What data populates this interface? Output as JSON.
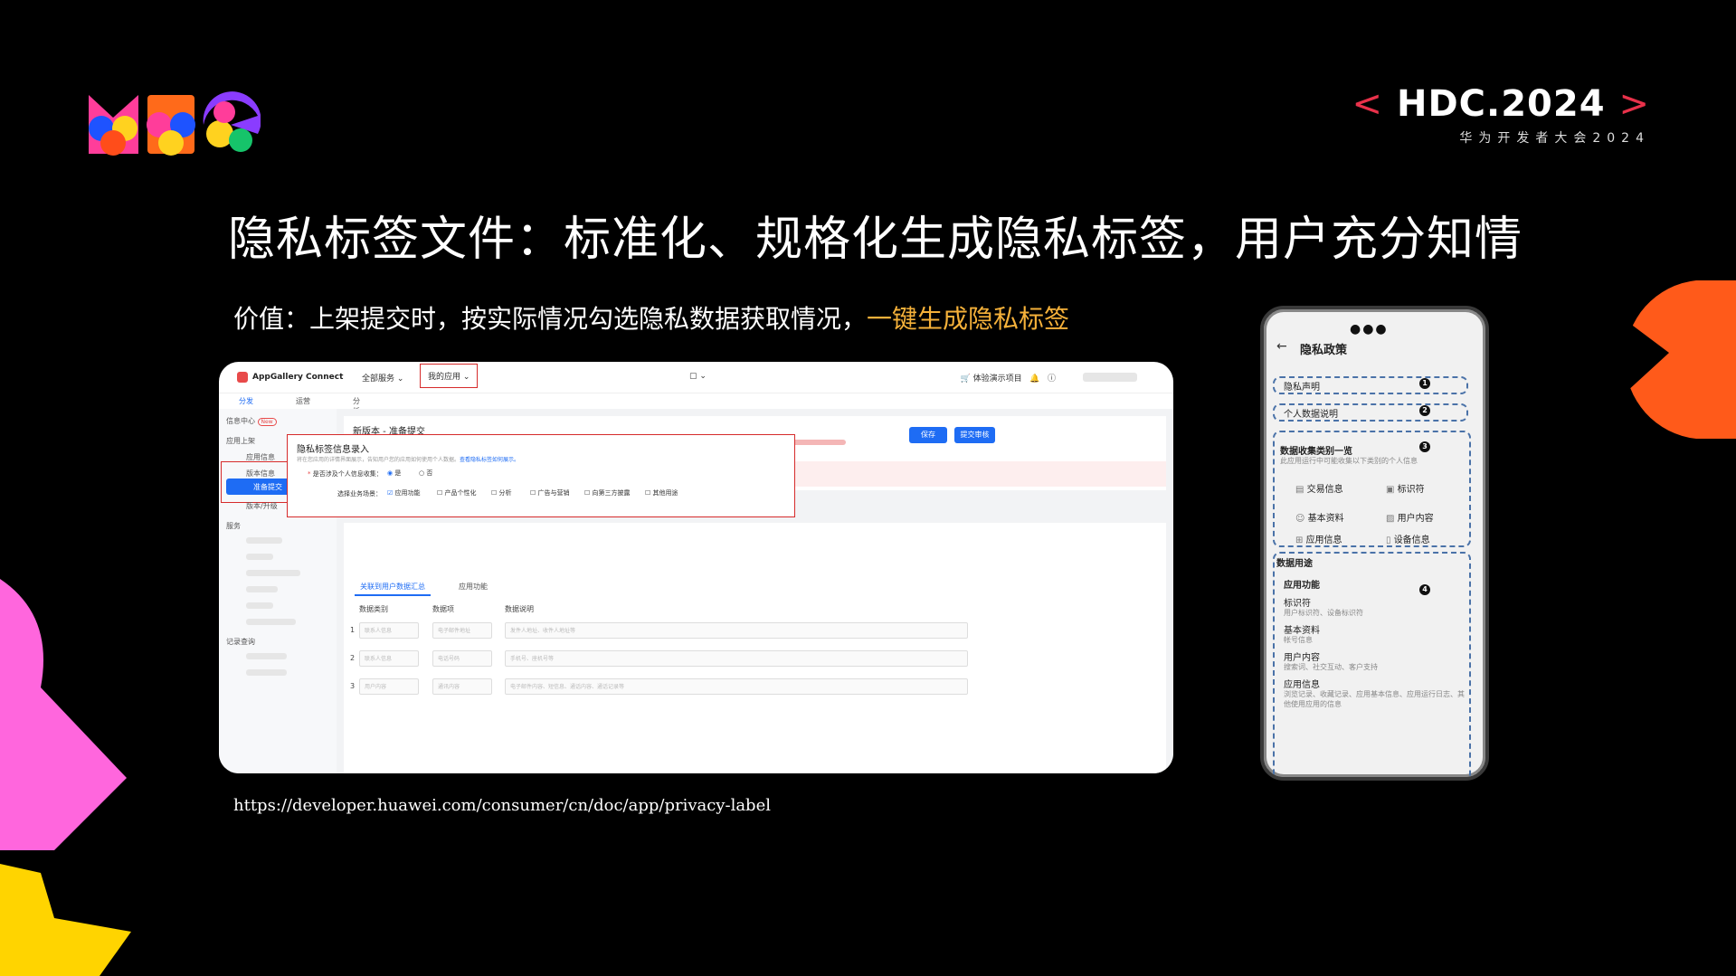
{
  "event": {
    "brand_left_bracket": "<",
    "brand_name": "HDC.2024",
    "brand_right_bracket": ">",
    "brand_sub": "华为开发者大会2024"
  },
  "slide": {
    "title": "隐私标签文件：标准化、规格化生成隐私标签，用户充分知情",
    "subtitle_prefix": "价值：上架提交时，按实际情况勾选隐私数据获取情况，",
    "subtitle_highlight": "一键生成隐私标签",
    "url": "https://developer.huawei.com/consumer/cn/doc/app/privacy-label"
  },
  "console": {
    "product": "AppGallery Connect",
    "menu_all": "全部服务",
    "menu_my": "我的应用",
    "demo": "体验演示项目",
    "tabs": [
      "分发",
      "运营",
      "分析"
    ],
    "sidebar": {
      "info_center": "信息中心",
      "new_badge": "New",
      "app_listing": "应用上架",
      "app_info": "应用信息",
      "version_info": "版本信息",
      "prepare_submit": "准备提交",
      "version_upgrade": "版本/升级",
      "services": "服务",
      "records": "记录查询"
    },
    "page_title": "新版本 - 准备提交",
    "save": "保存",
    "submit": "提交审核",
    "privacy": {
      "title": "隐私标签信息录入",
      "desc": "将在您应用的详情界面展示，告知用户您的应用如何使用个人数据。",
      "desc_link": "查看隐私标签如何展示。",
      "question": "是否涉及个人信息收集：",
      "yes": "是",
      "no": "否",
      "scene_label": "选择业务场景：",
      "scenes": [
        "应用功能",
        "产品个性化",
        "分析",
        "广告与营销",
        "向第三方披露",
        "其他用途"
      ]
    },
    "subtabs": [
      "关联到用户数据汇总",
      "应用功能"
    ],
    "columns": [
      "数据类别",
      "数据项",
      "数据说明"
    ],
    "rows": [
      {
        "n": "1",
        "c": "联系人信息",
        "i": "电子邮件地址",
        "d": "发件人地址、收件人地址等"
      },
      {
        "n": "2",
        "c": "联系人信息",
        "i": "电话号码",
        "d": "手机号、座机号等"
      },
      {
        "n": "3",
        "c": "用户内容",
        "i": "通讯内容",
        "d": "电子邮件内容、短信息、通话内容、通话记录等"
      }
    ]
  },
  "phone": {
    "title": "隐私政策",
    "privacy_statement": "隐私声明",
    "personal_data": "个人数据说明",
    "collection_title": "数据收集类别一览",
    "collection_desc": "此应用运行中可能收集以下类别的个人信息",
    "categories": [
      "交易信息",
      "标识符",
      "基本资料",
      "用户内容",
      "应用信息",
      "设备信息"
    ],
    "usage_title": "数据用途",
    "usage": {
      "section": "应用功能",
      "items": [
        {
          "name": "标识符",
          "desc": "用户标识符、设备标识符"
        },
        {
          "name": "基本资料",
          "desc": "帐号信息"
        },
        {
          "name": "用户内容",
          "desc": "搜索词、社交互动、客户支持"
        },
        {
          "name": "应用信息",
          "desc": "浏览记录、收藏记录、应用基本信息、应用运行日志、其他使用应用的信息"
        }
      ]
    },
    "markers": [
      "1",
      "2",
      "3",
      "4"
    ]
  }
}
